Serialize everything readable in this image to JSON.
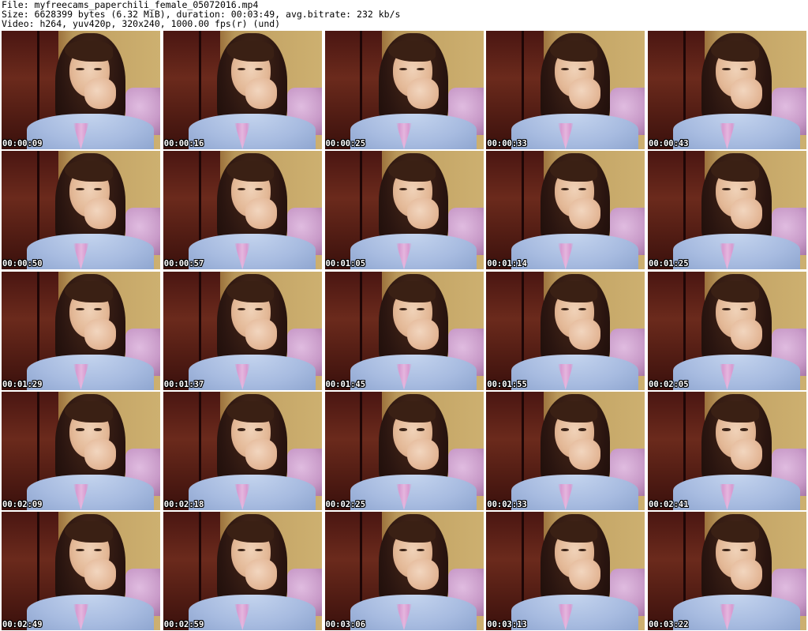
{
  "header": {
    "file_line": "File: myfreecams_paperchili_female_05072016.mp4",
    "size_line": "Size: 6628399 bytes (6.32 MiB), duration: 00:03:49, avg.bitrate: 232 kb/s",
    "video_line": "Video: h264, yuv420p, 320x240, 1000.00 fps(r) (und)"
  },
  "thumbnails": [
    {
      "timestamp": "00:00:09"
    },
    {
      "timestamp": "00:00:16"
    },
    {
      "timestamp": "00:00:25"
    },
    {
      "timestamp": "00:00:33"
    },
    {
      "timestamp": "00:00:43"
    },
    {
      "timestamp": "00:00:50"
    },
    {
      "timestamp": "00:00:57"
    },
    {
      "timestamp": "00:01:05"
    },
    {
      "timestamp": "00:01:14"
    },
    {
      "timestamp": "00:01:25"
    },
    {
      "timestamp": "00:01:29"
    },
    {
      "timestamp": "00:01:37"
    },
    {
      "timestamp": "00:01:45"
    },
    {
      "timestamp": "00:01:55"
    },
    {
      "timestamp": "00:02:05"
    },
    {
      "timestamp": "00:02:09"
    },
    {
      "timestamp": "00:02:18"
    },
    {
      "timestamp": "00:02:25"
    },
    {
      "timestamp": "00:02:33"
    },
    {
      "timestamp": "00:02:41"
    },
    {
      "timestamp": "00:02:49"
    },
    {
      "timestamp": "00:02:59"
    },
    {
      "timestamp": "00:03:06"
    },
    {
      "timestamp": "00:03:13"
    },
    {
      "timestamp": "00:03:22"
    }
  ]
}
